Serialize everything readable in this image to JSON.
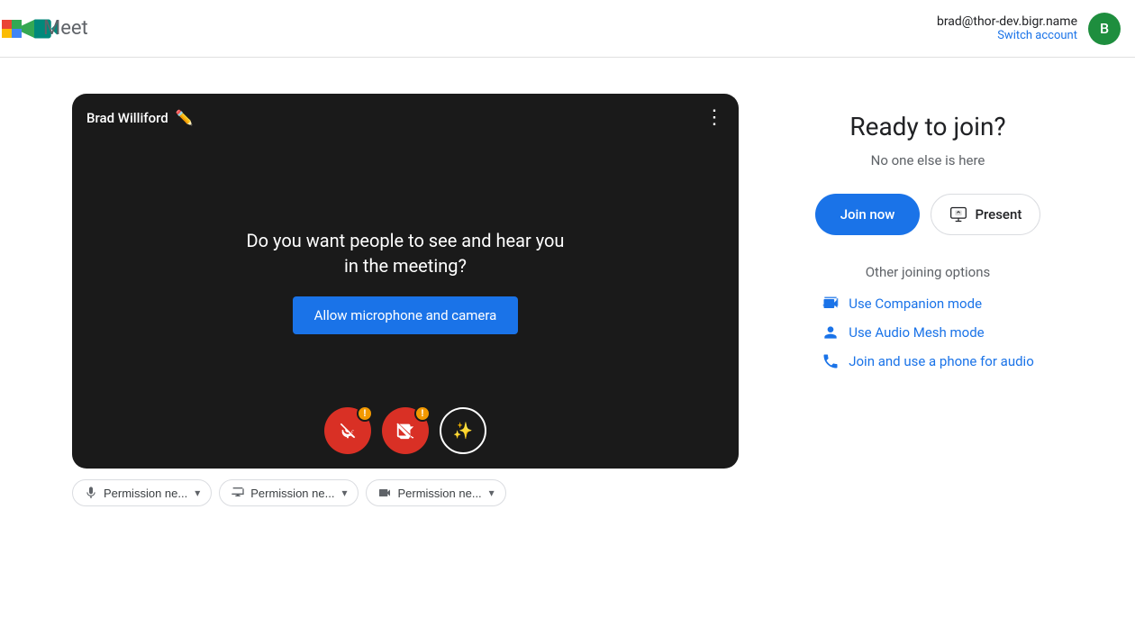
{
  "header": {
    "app_name": "Meet",
    "user_email": "brad@thor-dev.bigr.name",
    "switch_account_label": "Switch account",
    "avatar_letter": "B"
  },
  "video": {
    "username": "Brad Williford",
    "message": "Do you want people to see and hear you in the meeting?",
    "allow_btn_label": "Allow microphone and camera"
  },
  "permissions": [
    {
      "label": "Permission ne..."
    },
    {
      "label": "Permission ne..."
    },
    {
      "label": "Permission ne..."
    }
  ],
  "join_panel": {
    "title": "Ready to join?",
    "subtitle": "No one else is here",
    "join_now_label": "Join now",
    "present_label": "Present",
    "other_options_title": "Other joining options",
    "options": [
      {
        "label": "Use Companion mode"
      },
      {
        "label": "Use Audio Mesh mode"
      },
      {
        "label": "Join and use a phone for audio"
      }
    ]
  }
}
